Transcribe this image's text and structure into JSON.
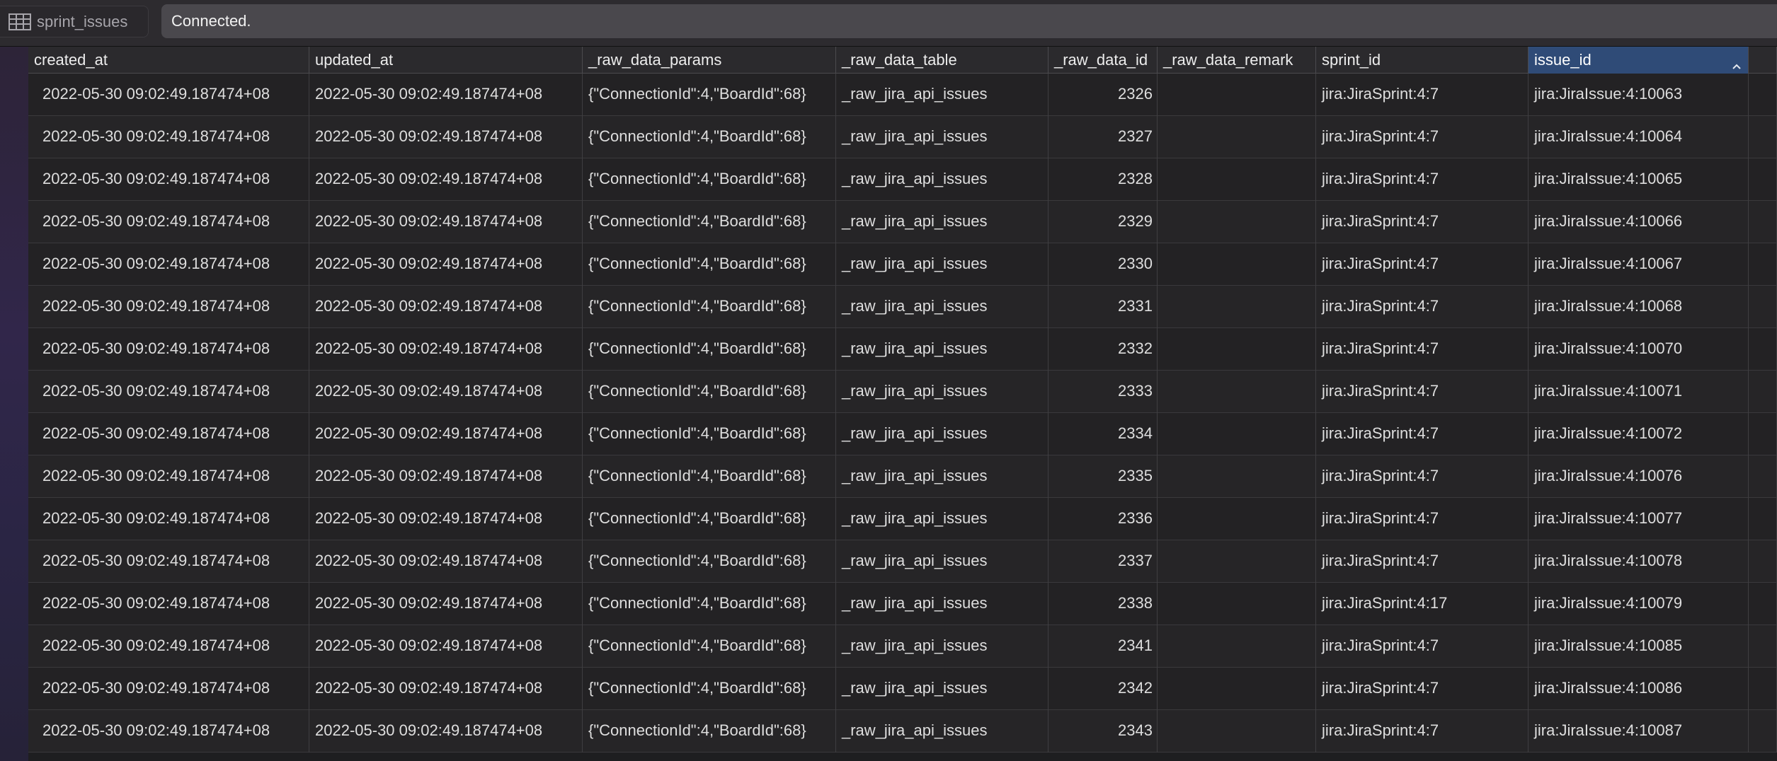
{
  "tab": {
    "icon": "table-icon",
    "label": "sprint_issues"
  },
  "status": {
    "text": "Connected."
  },
  "columns": [
    "created_at",
    "updated_at",
    "_raw_data_params",
    "_raw_data_table",
    "_raw_data_id",
    "_raw_data_remark",
    "sprint_id",
    "issue_id"
  ],
  "selected_column": "issue_id",
  "sort_direction": "ascending",
  "colors": {
    "selected_header": "#2f4b77",
    "background": "#1e1e20",
    "accent_strip": "#31264a"
  },
  "rows": [
    [
      "2022-05-30 09:02:49.187474+08",
      "2022-05-30 09:02:49.187474+08",
      "{\"ConnectionId\":4,\"BoardId\":68}",
      "_raw_jira_api_issues",
      "2326",
      "",
      "jira:JiraSprint:4:7",
      "jira:JiraIssue:4:10063"
    ],
    [
      "2022-05-30 09:02:49.187474+08",
      "2022-05-30 09:02:49.187474+08",
      "{\"ConnectionId\":4,\"BoardId\":68}",
      "_raw_jira_api_issues",
      "2327",
      "",
      "jira:JiraSprint:4:7",
      "jira:JiraIssue:4:10064"
    ],
    [
      "2022-05-30 09:02:49.187474+08",
      "2022-05-30 09:02:49.187474+08",
      "{\"ConnectionId\":4,\"BoardId\":68}",
      "_raw_jira_api_issues",
      "2328",
      "",
      "jira:JiraSprint:4:7",
      "jira:JiraIssue:4:10065"
    ],
    [
      "2022-05-30 09:02:49.187474+08",
      "2022-05-30 09:02:49.187474+08",
      "{\"ConnectionId\":4,\"BoardId\":68}",
      "_raw_jira_api_issues",
      "2329",
      "",
      "jira:JiraSprint:4:7",
      "jira:JiraIssue:4:10066"
    ],
    [
      "2022-05-30 09:02:49.187474+08",
      "2022-05-30 09:02:49.187474+08",
      "{\"ConnectionId\":4,\"BoardId\":68}",
      "_raw_jira_api_issues",
      "2330",
      "",
      "jira:JiraSprint:4:7",
      "jira:JiraIssue:4:10067"
    ],
    [
      "2022-05-30 09:02:49.187474+08",
      "2022-05-30 09:02:49.187474+08",
      "{\"ConnectionId\":4,\"BoardId\":68}",
      "_raw_jira_api_issues",
      "2331",
      "",
      "jira:JiraSprint:4:7",
      "jira:JiraIssue:4:10068"
    ],
    [
      "2022-05-30 09:02:49.187474+08",
      "2022-05-30 09:02:49.187474+08",
      "{\"ConnectionId\":4,\"BoardId\":68}",
      "_raw_jira_api_issues",
      "2332",
      "",
      "jira:JiraSprint:4:7",
      "jira:JiraIssue:4:10070"
    ],
    [
      "2022-05-30 09:02:49.187474+08",
      "2022-05-30 09:02:49.187474+08",
      "{\"ConnectionId\":4,\"BoardId\":68}",
      "_raw_jira_api_issues",
      "2333",
      "",
      "jira:JiraSprint:4:7",
      "jira:JiraIssue:4:10071"
    ],
    [
      "2022-05-30 09:02:49.187474+08",
      "2022-05-30 09:02:49.187474+08",
      "{\"ConnectionId\":4,\"BoardId\":68}",
      "_raw_jira_api_issues",
      "2334",
      "",
      "jira:JiraSprint:4:7",
      "jira:JiraIssue:4:10072"
    ],
    [
      "2022-05-30 09:02:49.187474+08",
      "2022-05-30 09:02:49.187474+08",
      "{\"ConnectionId\":4,\"BoardId\":68}",
      "_raw_jira_api_issues",
      "2335",
      "",
      "jira:JiraSprint:4:7",
      "jira:JiraIssue:4:10076"
    ],
    [
      "2022-05-30 09:02:49.187474+08",
      "2022-05-30 09:02:49.187474+08",
      "{\"ConnectionId\":4,\"BoardId\":68}",
      "_raw_jira_api_issues",
      "2336",
      "",
      "jira:JiraSprint:4:7",
      "jira:JiraIssue:4:10077"
    ],
    [
      "2022-05-30 09:02:49.187474+08",
      "2022-05-30 09:02:49.187474+08",
      "{\"ConnectionId\":4,\"BoardId\":68}",
      "_raw_jira_api_issues",
      "2337",
      "",
      "jira:JiraSprint:4:7",
      "jira:JiraIssue:4:10078"
    ],
    [
      "2022-05-30 09:02:49.187474+08",
      "2022-05-30 09:02:49.187474+08",
      "{\"ConnectionId\":4,\"BoardId\":68}",
      "_raw_jira_api_issues",
      "2338",
      "",
      "jira:JiraSprint:4:17",
      "jira:JiraIssue:4:10079"
    ],
    [
      "2022-05-30 09:02:49.187474+08",
      "2022-05-30 09:02:49.187474+08",
      "{\"ConnectionId\":4,\"BoardId\":68}",
      "_raw_jira_api_issues",
      "2341",
      "",
      "jira:JiraSprint:4:7",
      "jira:JiraIssue:4:10085"
    ],
    [
      "2022-05-30 09:02:49.187474+08",
      "2022-05-30 09:02:49.187474+08",
      "{\"ConnectionId\":4,\"BoardId\":68}",
      "_raw_jira_api_issues",
      "2342",
      "",
      "jira:JiraSprint:4:7",
      "jira:JiraIssue:4:10086"
    ],
    [
      "2022-05-30 09:02:49.187474+08",
      "2022-05-30 09:02:49.187474+08",
      "{\"ConnectionId\":4,\"BoardId\":68}",
      "_raw_jira_api_issues",
      "2343",
      "",
      "jira:JiraSprint:4:7",
      "jira:JiraIssue:4:10087"
    ]
  ]
}
